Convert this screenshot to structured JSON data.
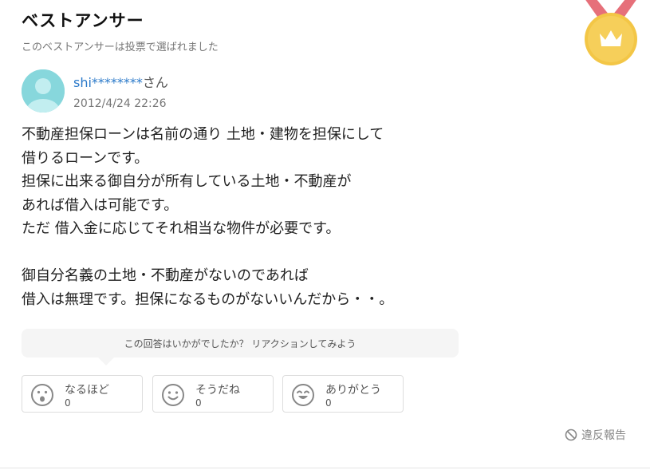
{
  "header": {
    "title": "ベストアンサー",
    "subtitle": "このベストアンサーは投票で選ばれました"
  },
  "medal": {
    "icon": "crown-medal-icon",
    "color": "#f3c646",
    "ribbon_color": "#e6707a"
  },
  "answer": {
    "user_name": "shi********",
    "user_suffix": "さん",
    "date": "2012/4/24 22:26",
    "lines": [
      "不動産担保ローンは名前の通り 土地・建物を担保にして",
      "借りるローンです。",
      "担保に出来る御自分が所有している土地・不動産が",
      "あれば借入は可能です。",
      "ただ 借入金に応じてそれ相当な物件が必要です。",
      "",
      "御自分名義の土地・不動産がないのであれば",
      "借入は無理です。担保になるものがないいんだから・・。"
    ]
  },
  "reaction_prompt": "この回答はいかがでしたか？ リアクションしてみよう",
  "reactions": [
    {
      "label": "なるほど",
      "count": "0",
      "icon": "surprised-face-icon"
    },
    {
      "label": "そうだね",
      "count": "0",
      "icon": "smile-face-icon"
    },
    {
      "label": "ありがとう",
      "count": "0",
      "icon": "grin-face-icon"
    }
  ],
  "report_label": "違反報告"
}
